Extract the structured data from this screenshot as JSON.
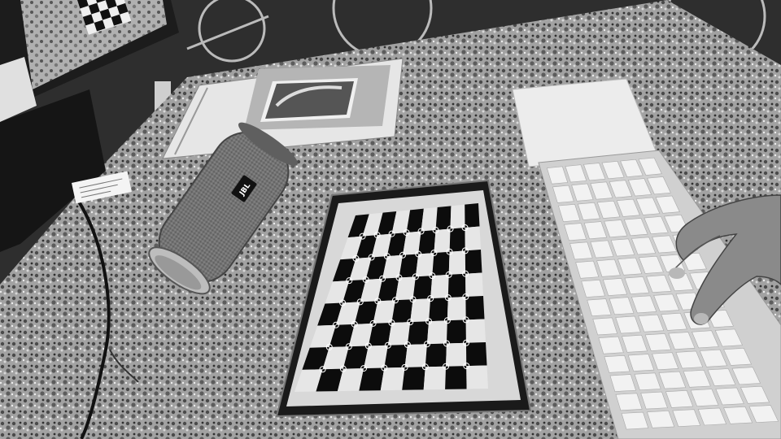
{
  "scene": {
    "description_type": "photograph",
    "colors": {
      "floor": "#2e2e2e",
      "tablecloth": "#9a9a9a",
      "tablet_screen": "#d8d8d8",
      "checker_dark": "#0c0c0c",
      "checker_light": "#e6e6e6",
      "keyboard_body": "#d6d6d6",
      "key": "#f2f2f2",
      "trackpad": "#ececec",
      "speaker_mesh": "#6e6e6e"
    }
  },
  "speaker": {
    "brand_logo": "JBL"
  },
  "checkerboard": {
    "rows": 8,
    "cols": 9
  }
}
